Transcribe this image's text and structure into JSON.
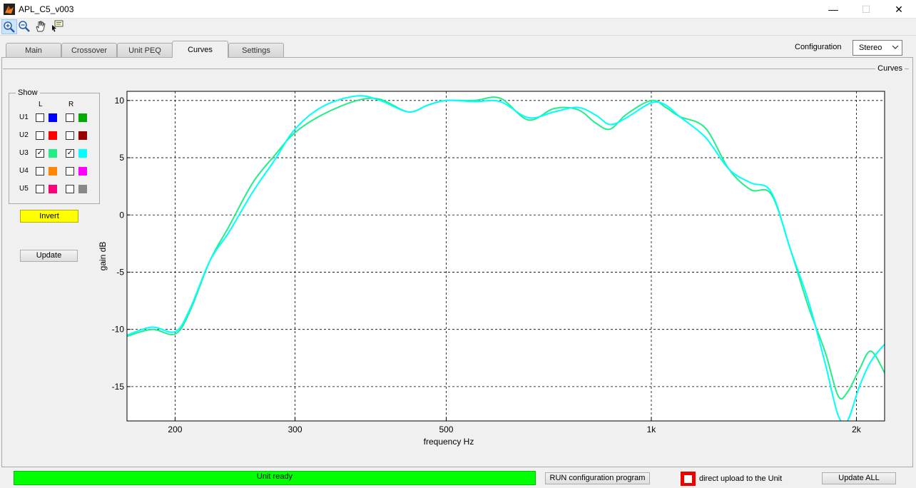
{
  "window": {
    "title": "APL_C5_v003",
    "minimize_glyph": "—",
    "maximize_glyph": "☐",
    "close_glyph": "✕"
  },
  "toolbar": {
    "tools": [
      "zoom-in-icon",
      "zoom-out-icon",
      "pan-hand-icon",
      "data-cursor-icon"
    ]
  },
  "tabs": [
    {
      "label": "Main",
      "active": false
    },
    {
      "label": "Crossover",
      "active": false
    },
    {
      "label": "Unit PEQ",
      "active": false
    },
    {
      "label": "Curves",
      "active": true
    },
    {
      "label": "Settings",
      "active": false
    }
  ],
  "configuration": {
    "label": "Configuration",
    "value": "Stereo"
  },
  "curves_panel": {
    "title": "Curves"
  },
  "show_panel": {
    "title": "Show",
    "col_left": "L",
    "col_right": "R",
    "rows": [
      {
        "label": "U1",
        "left_checked": false,
        "left_color": "#0000ff",
        "right_checked": false,
        "right_color": "#00aa00"
      },
      {
        "label": "U2",
        "left_checked": false,
        "left_color": "#ff0000",
        "right_checked": false,
        "right_color": "#990000"
      },
      {
        "label": "U3",
        "left_checked": true,
        "left_color": "#22ee88",
        "right_checked": true,
        "right_color": "#00ffff"
      },
      {
        "label": "U4",
        "left_checked": false,
        "left_color": "#ff8800",
        "right_checked": false,
        "right_color": "#ff00ff"
      },
      {
        "label": "U5",
        "left_checked": false,
        "left_color": "#ff0077",
        "right_checked": false,
        "right_color": "#888888"
      }
    ],
    "check_glyph": "✓"
  },
  "buttons": {
    "invert": "Invert",
    "invert_color": "#ffff00",
    "update": "Update",
    "run_config": "RUN configuration program",
    "update_all": "Update ALL"
  },
  "status": {
    "text": "Unit ready",
    "color": "#00ff00"
  },
  "direct_upload": {
    "label": "direct upload to the Unit",
    "color": "#ee0000"
  },
  "chart_data": {
    "type": "line",
    "title": "",
    "xlabel": "frequency   Hz",
    "ylabel": "gain dB",
    "xscale": "log",
    "xlim": [
      170,
      2200
    ],
    "ylim": [
      -18,
      10.8
    ],
    "xticks": [
      200,
      300,
      500,
      1000,
      2000
    ],
    "xtick_labels": [
      "200",
      "300",
      "500",
      "1k",
      "2k"
    ],
    "yticks": [
      10,
      5,
      0,
      -5,
      -10,
      -15
    ],
    "ytick_labels": [
      "10",
      "5",
      "0",
      "-5",
      "-10",
      "-15"
    ],
    "grid": true,
    "series": [
      {
        "color": "#22ee88",
        "x": [
          170,
          185,
          200,
          210,
          225,
          240,
          260,
          280,
          300,
          330,
          370,
          400,
          440,
          470,
          500,
          550,
          600,
          660,
          720,
          780,
          830,
          870,
          920,
          1000,
          1050,
          1100,
          1200,
          1300,
          1400,
          1500,
          1600,
          1700,
          1800,
          1880,
          1940,
          2020,
          2100,
          2200
        ],
        "y": [
          -10.6,
          -10.0,
          -10.4,
          -8.5,
          -4.0,
          -1.0,
          2.8,
          5.2,
          7.2,
          8.8,
          10.0,
          10.1,
          9.0,
          9.6,
          10.0,
          10.0,
          10.2,
          8.3,
          9.3,
          9.2,
          8.0,
          7.5,
          8.8,
          10.0,
          9.4,
          8.6,
          7.6,
          4.0,
          2.2,
          1.8,
          -3.0,
          -8.0,
          -12.0,
          -15.8,
          -15.5,
          -13.5,
          -11.9,
          -13.8
        ]
      },
      {
        "color": "#00ffff",
        "x": [
          170,
          185,
          200,
          210,
          225,
          240,
          260,
          280,
          300,
          330,
          370,
          400,
          440,
          470,
          500,
          550,
          600,
          660,
          720,
          780,
          830,
          870,
          920,
          1000,
          1050,
          1100,
          1200,
          1300,
          1400,
          1500,
          1600,
          1700,
          1800,
          1880,
          1940,
          2020,
          2100,
          2200
        ],
        "y": [
          -10.5,
          -9.8,
          -10.2,
          -8.3,
          -4.0,
          -1.5,
          2.0,
          4.8,
          7.5,
          9.5,
          10.4,
          10.0,
          9.0,
          9.6,
          10.0,
          9.9,
          9.9,
          8.5,
          9.0,
          9.4,
          8.7,
          7.9,
          8.5,
          9.8,
          9.6,
          8.6,
          6.8,
          4.0,
          2.8,
          2.0,
          -3.0,
          -7.5,
          -13.0,
          -17.5,
          -18.0,
          -15.0,
          -12.8,
          -11.3
        ]
      }
    ]
  }
}
